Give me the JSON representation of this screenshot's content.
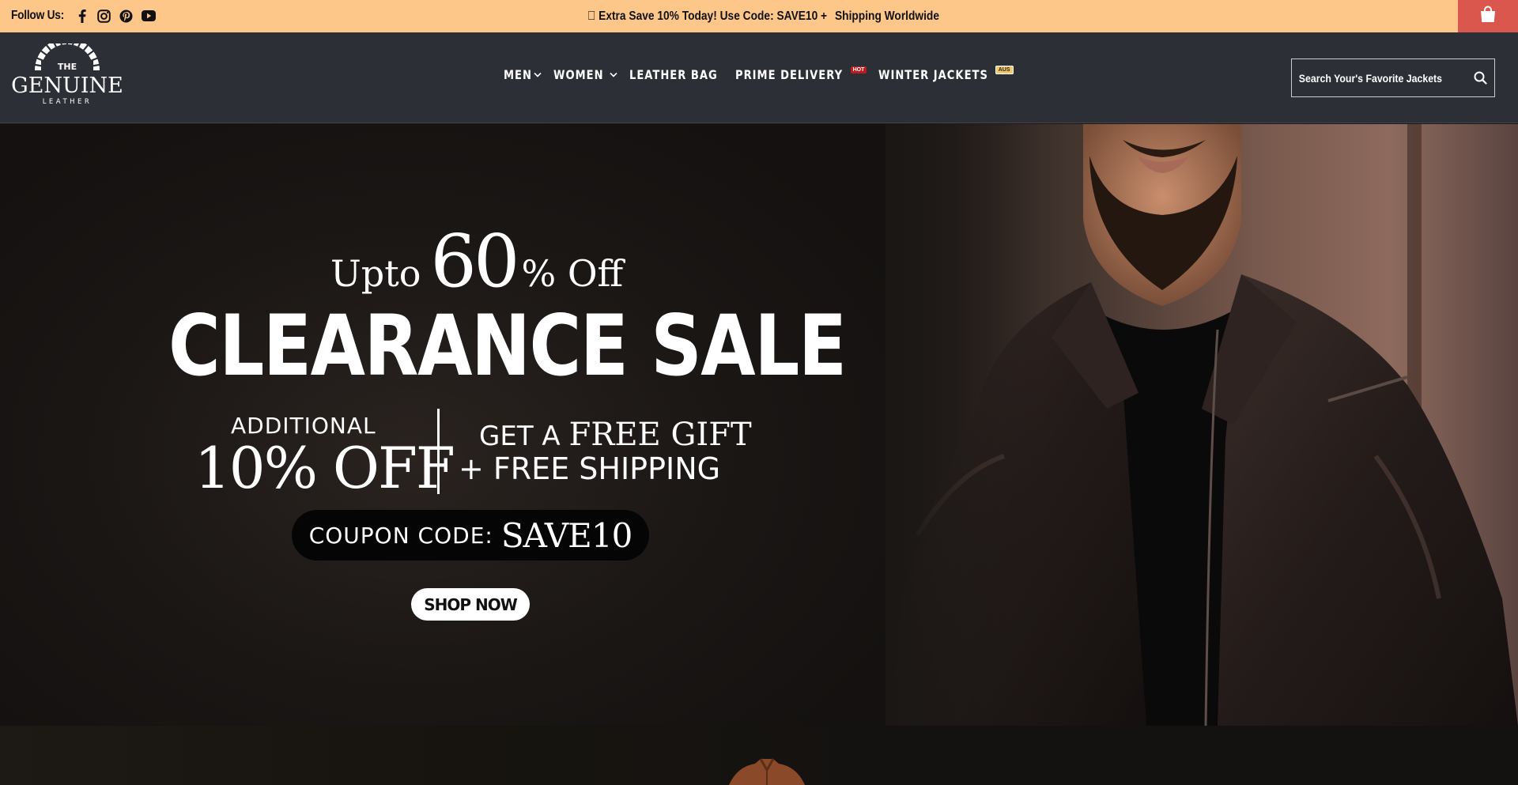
{
  "topbar": {
    "follow_label": "Follow Us:",
    "social": [
      "facebook-icon",
      "instagram-icon",
      "pinterest-icon",
      "youtube-icon"
    ],
    "promo_text": "\u0000 Extra Save 10% Today! Use Code: SAVE10 +",
    "promo_text_2": "Shipping Worldwide",
    "background": "#fec78a",
    "cart_color": "#d9574c"
  },
  "header": {
    "logo": {
      "line1": "THE",
      "line2": "GENUINE",
      "line3": "LEATHER"
    },
    "nav": [
      {
        "label": "MEN",
        "has_dropdown": true
      },
      {
        "label": "WOMEN",
        "has_dropdown": true
      },
      {
        "label": "LEATHER BAG"
      },
      {
        "label": "PRIME DELIVERY",
        "badge": "HOT"
      },
      {
        "label": "WINTER JACKETS",
        "badge": "AUS"
      }
    ],
    "search_placeholder": "Search Your's Favorite Jackets",
    "background": "#2c3036"
  },
  "hero": {
    "upto": "Upto",
    "sixty": "60",
    "percent_off": "% Off",
    "headline": "CLEARANCE SALE",
    "additional": "ADDITIONAL",
    "ten_off": "10% OFF",
    "get_a": "GET A",
    "free_gift": "FREE GIFT",
    "free_shipping": "+ FREE SHIPPING",
    "coupon_label": "COUPON CODE:",
    "coupon_code": "SAVE10",
    "cta": "SHOP NOW"
  }
}
